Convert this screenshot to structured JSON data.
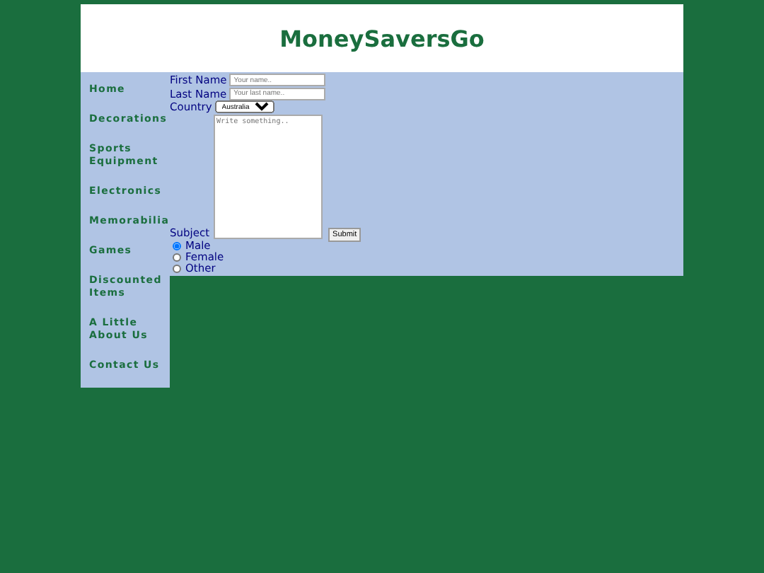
{
  "header": {
    "title": "MoneySaversGo"
  },
  "nav": [
    {
      "label": "Home"
    },
    {
      "label": "Decorations"
    },
    {
      "label": "Sports Equipment"
    },
    {
      "label": "Electronics"
    },
    {
      "label": "Memorabilia"
    },
    {
      "label": "Games"
    },
    {
      "label": "Discounted Items"
    },
    {
      "label": "A Little About Us"
    },
    {
      "label": "Contact Us"
    }
  ],
  "form": {
    "first_name": {
      "label": "First Name",
      "placeholder": "Your name.."
    },
    "last_name": {
      "label": "Last Name",
      "placeholder": "Your last name.."
    },
    "country": {
      "label": "Country",
      "value": "Australia"
    },
    "subject": {
      "label": "Subject",
      "placeholder": "Write something.."
    },
    "submit": "Submit",
    "gender": [
      {
        "label": "Male",
        "selected": true
      },
      {
        "label": "Female",
        "selected": false
      },
      {
        "label": "Other",
        "selected": false
      }
    ]
  }
}
